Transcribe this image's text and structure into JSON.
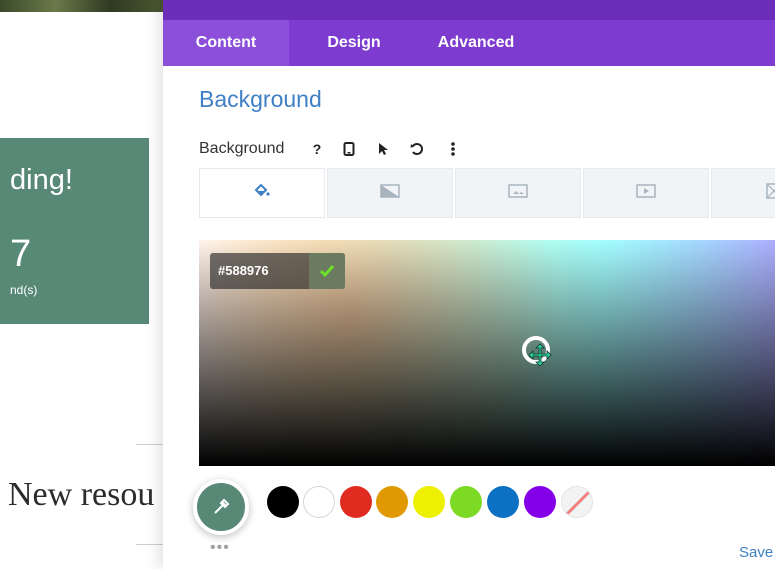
{
  "page": {
    "card": {
      "heading": "ding!",
      "number": "7",
      "unit": "nd(s)",
      "color": "#588976"
    },
    "new_resources": "New resou"
  },
  "modal": {
    "tabs": [
      {
        "label": "Content",
        "active": true
      },
      {
        "label": "Design",
        "active": false
      },
      {
        "label": "Advanced",
        "active": false
      }
    ],
    "section_title": "Background",
    "background_label": "Background",
    "controls": [
      "help-icon",
      "mobile-icon",
      "cursor-icon",
      "undo-icon",
      "more-icon"
    ],
    "type_tabs": [
      "paint-bucket-icon",
      "gradient-icon",
      "image-icon",
      "video-icon",
      "pattern-icon"
    ],
    "color_picker": {
      "hex": "#588976"
    },
    "swatches": [
      "#000000",
      "#ffffff",
      "#e02b20",
      "#e09900",
      "#edf000",
      "#7cda24",
      "#0c71c3",
      "#8300e9",
      "transparent"
    ],
    "more_label": "•••",
    "saved_label": "Save"
  }
}
